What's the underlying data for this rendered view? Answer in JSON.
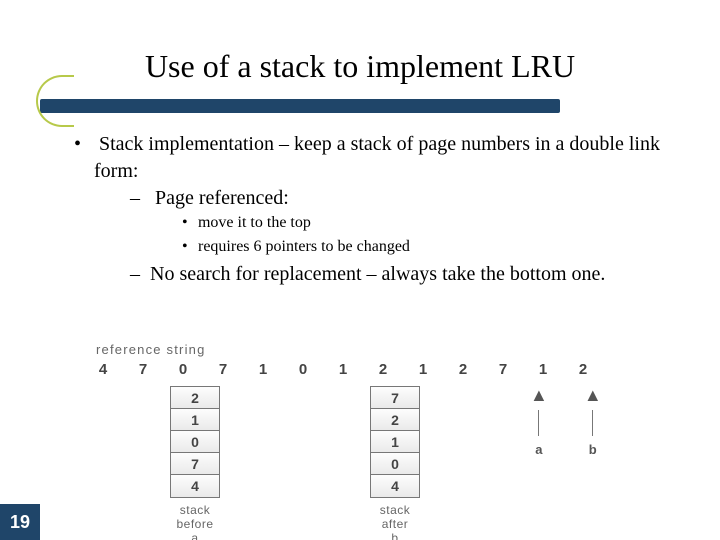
{
  "title": "Use of a stack to implement LRU",
  "bullets": {
    "b1": "Stack implementation – keep a stack of page numbers in a double link form:",
    "b1a": "Page referenced:",
    "b1a1": "move it to the top",
    "b1a2": "requires 6 pointers to be changed",
    "b1b": "No search for replacement – always take the bottom one."
  },
  "figure": {
    "ref_label": "reference string",
    "refs": [
      "4",
      "7",
      "0",
      "7",
      "1",
      "0",
      "1",
      "2",
      "1",
      "2",
      "7",
      "1",
      "2"
    ],
    "stack_before": {
      "cells": [
        "2",
        "1",
        "0",
        "7",
        "4"
      ],
      "label_l1": "stack",
      "label_l2": "before",
      "label_l3": "a"
    },
    "stack_after": {
      "cells": [
        "7",
        "2",
        "1",
        "0",
        "4"
      ],
      "label_l1": "stack",
      "label_l2": "after",
      "label_l3": "b"
    },
    "arrow_a": "a",
    "arrow_b": "b"
  },
  "page_number": "19"
}
